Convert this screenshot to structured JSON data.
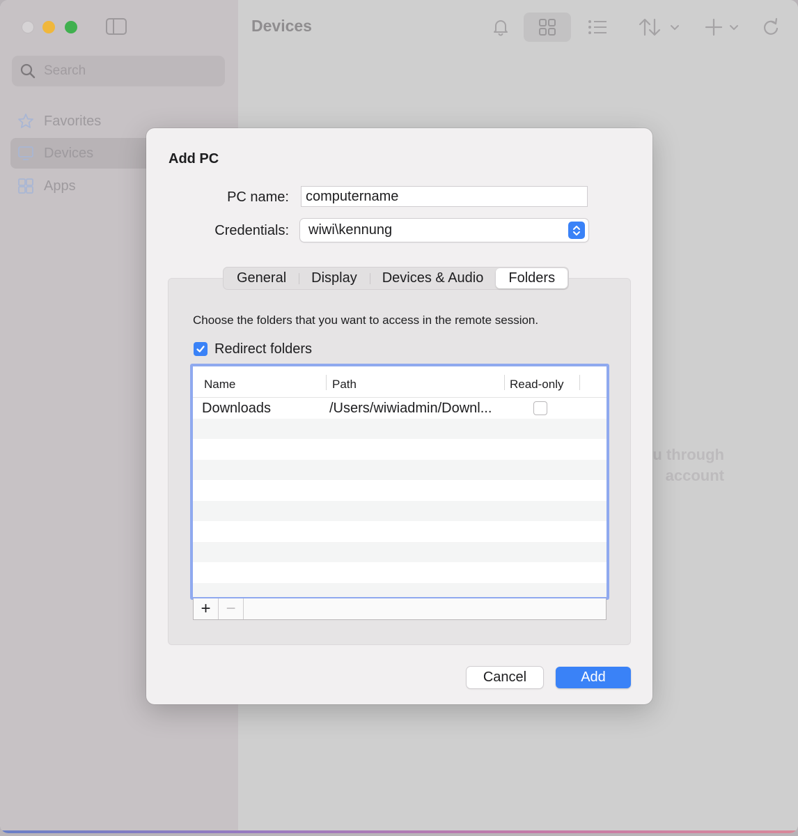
{
  "window": {
    "title": "Devices",
    "search_placeholder": "Search",
    "sidebar": {
      "items": [
        {
          "label": "Favorites",
          "icon": "star-icon"
        },
        {
          "label": "Devices",
          "icon": "monitor-icon"
        },
        {
          "label": "Apps",
          "icon": "apps-icon"
        }
      ]
    },
    "background_text": [
      "u through",
      "account"
    ]
  },
  "dialog": {
    "title": "Add PC",
    "pc_name_label": "PC name:",
    "pc_name_value": "computername",
    "credentials_label": "Credentials:",
    "credentials_value": "wiwi\\kennung",
    "tabs": [
      {
        "label": "General",
        "selected": false
      },
      {
        "label": "Display",
        "selected": false
      },
      {
        "label": "Devices & Audio",
        "selected": false
      },
      {
        "label": "Folders",
        "selected": true
      }
    ],
    "folders": {
      "description": "Choose the folders that you want to access in the remote session.",
      "redirect_label": "Redirect folders",
      "redirect_checked": true,
      "columns": [
        "Name",
        "Path",
        "Read-only"
      ],
      "rows": [
        {
          "name": "Downloads",
          "path": "/Users/wiwiadmin/Downl...",
          "read_only": false
        }
      ],
      "add_symbol": "+",
      "remove_symbol": "−"
    },
    "cancel_label": "Cancel",
    "add_label": "Add"
  },
  "colors": {
    "accent": "#3a82f7",
    "table_focus_ring": "#8fa9ef"
  }
}
